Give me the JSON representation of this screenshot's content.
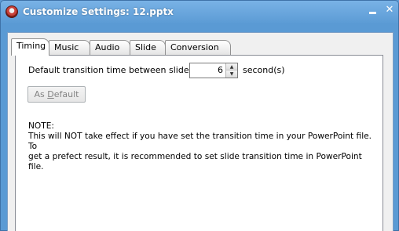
{
  "window": {
    "title": "Customize Settings: 12.pptx",
    "minimize_glyph": "",
    "close_glyph": "✕"
  },
  "tabs": [
    {
      "label": "Timing",
      "active": true
    },
    {
      "label": "Music",
      "active": false
    },
    {
      "label": "Audio",
      "active": false
    },
    {
      "label": "Slide",
      "active": false
    },
    {
      "label": "Conversion",
      "active": false
    }
  ],
  "timing": {
    "transition_label": "Default transition time between slides:",
    "transition_value": "6",
    "unit_label": "second(s)",
    "as_default_prefix": "As ",
    "as_default_underlined": "D",
    "as_default_suffix": "efault",
    "note_heading": "NOTE:",
    "note_line1": "This will NOT take effect if you have set the transition time in your PowerPoint file. To",
    "note_line2": "get a prefect result, it is recommended to set slide transition time in PowerPoint file."
  },
  "icons": {
    "app": "app-logo-icon",
    "spin_up": "▲",
    "spin_down": "▼"
  }
}
